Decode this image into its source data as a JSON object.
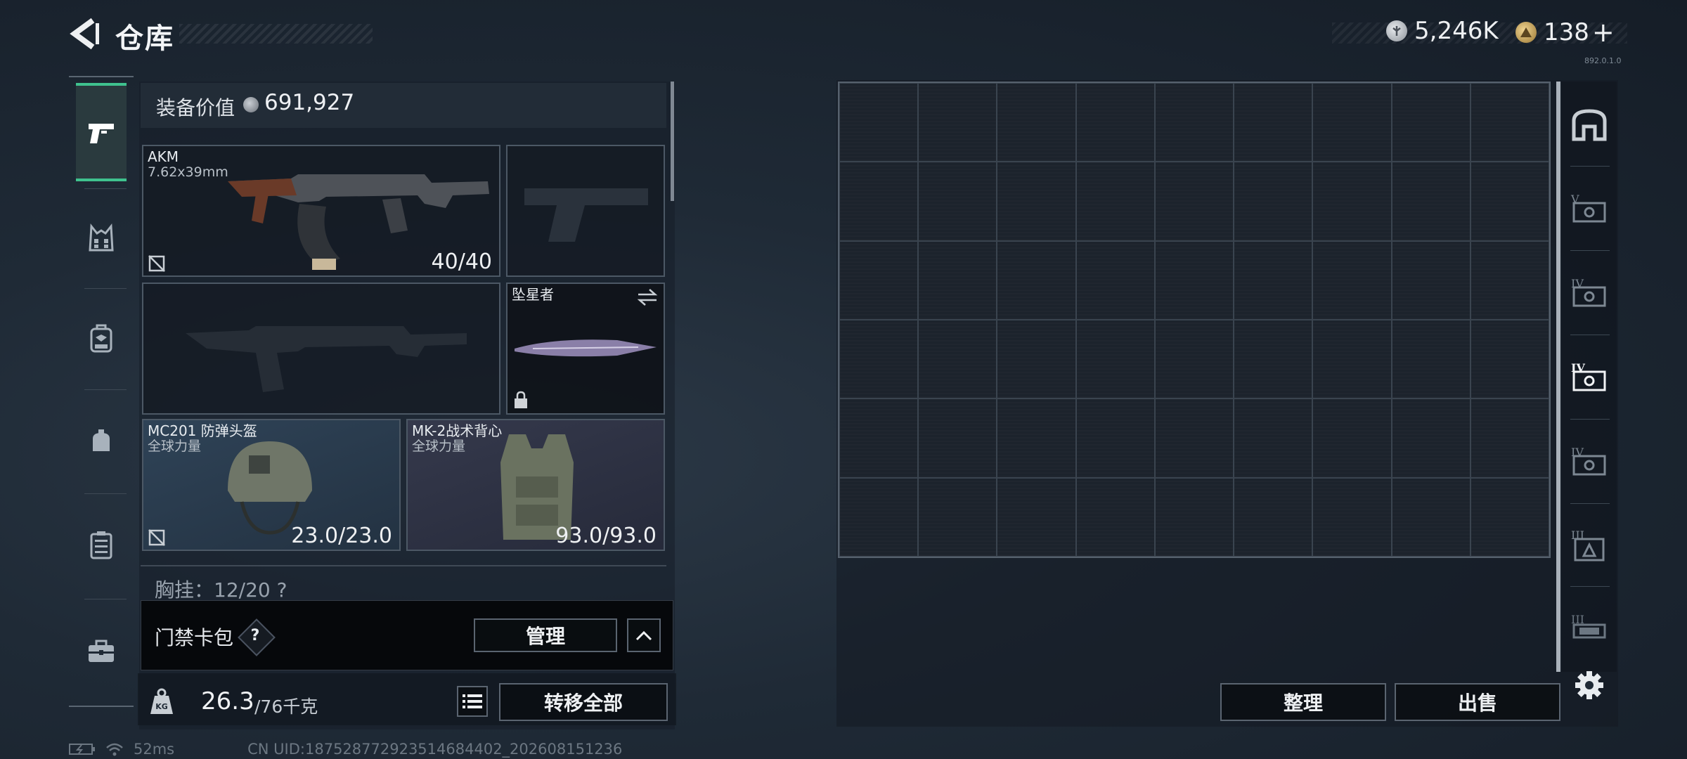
{
  "header": {
    "title": "仓库"
  },
  "currency": {
    "silver": {
      "value": "5,246K",
      "color": "#b7bcc3"
    },
    "gold": {
      "value": "138",
      "plus": "+",
      "color": "#c9a55a"
    },
    "version_tiny": "892.0.1.0"
  },
  "categories": [
    {
      "icon": "pistol-icon",
      "active": true
    },
    {
      "icon": "rig-vest-icon",
      "active": false
    },
    {
      "icon": "backpack-icon",
      "active": false
    },
    {
      "icon": "pouch-icon",
      "active": false
    },
    {
      "icon": "keycase-icon",
      "active": false
    },
    {
      "icon": "toolkit-icon",
      "active": false
    }
  ],
  "equipment": {
    "value_label": "装备价值",
    "value": "691,927",
    "primary": {
      "name": "AKM",
      "caliber": "7.62x39mm",
      "durability": "40/40"
    },
    "melee": {
      "name": "坠星者"
    },
    "helmet": {
      "name": "MC201 防弹头盔",
      "faction": "全球力量",
      "durability": "23.0/23.0"
    },
    "vest": {
      "name": "MK-2战术背心",
      "faction": "全球力量",
      "durability": "93.0/93.0"
    },
    "chest_rig": "胸挂：12/20 ?"
  },
  "keycard": {
    "label": "门禁卡包",
    "help": "?",
    "manage_label": "管理"
  },
  "weight": {
    "current": "26.3",
    "max": "/76千克",
    "transfer_all": "转移全部"
  },
  "stash": {
    "sort_label": "整理",
    "sell_label": "出售",
    "columns": 9,
    "rows": 6
  },
  "status": {
    "ping": "52ms",
    "uid": "CN UID:18752877292351468440​2_202608151236"
  },
  "accent": "#3fc28e"
}
